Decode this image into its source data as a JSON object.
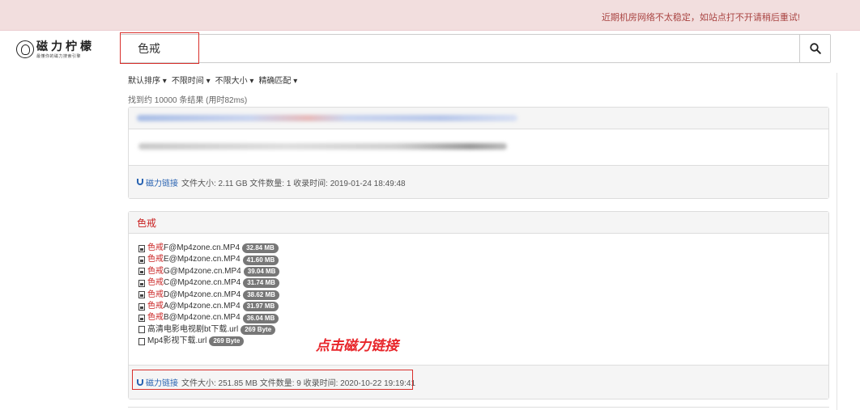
{
  "notice": {
    "text": "近期机房网络不太稳定，如站点打不开请稍后重试!"
  },
  "logo": {
    "title": "磁力柠檬",
    "subtitle": "最懂你的磁力搜索引擎"
  },
  "search": {
    "value": "色戒",
    "button_icon": "search-icon"
  },
  "filters": [
    "默认排序 ▾",
    "不限时间 ▾",
    "不限大小 ▾",
    "精确匹配 ▾"
  ],
  "result_count": "找到约 10000 条结果 (用时82ms)",
  "results": [
    {
      "title": "",
      "magnet_label": "磁力链接",
      "meta": "文件大小: 2.11 GB 文件数量: 1 收录时间: 2019-01-24 18:49:48"
    },
    {
      "title": "色戒",
      "magnet_label": "磁力链接",
      "meta": "文件大小: 251.85 MB 文件数量: 9 收录时间: 2020-10-22 19:19:41",
      "files": [
        {
          "highlight": "色戒",
          "name": "F@Mp4zone.cn.MP4",
          "size": "32.84 MB"
        },
        {
          "highlight": "色戒",
          "name": "E@Mp4zone.cn.MP4",
          "size": "41.60 MB"
        },
        {
          "highlight": "色戒",
          "name": "G@Mp4zone.cn.MP4",
          "size": "39.04 MB"
        },
        {
          "highlight": "色戒",
          "name": "C@Mp4zone.cn.MP4",
          "size": "31.74 MB"
        },
        {
          "highlight": "色戒",
          "name": "D@Mp4zone.cn.MP4",
          "size": "38.62 MB"
        },
        {
          "highlight": "色戒",
          "name": "A@Mp4zone.cn.MP4",
          "size": "31.97 MB"
        },
        {
          "highlight": "色戒",
          "name": "B@Mp4zone.cn.MP4",
          "size": "36.04 MB"
        },
        {
          "highlight": "",
          "name": "高清电影电视剧bt下载.url",
          "size": "269 Byte"
        },
        {
          "highlight": "",
          "name": "Mp4影视下载.url",
          "size": "269 Byte"
        }
      ]
    }
  ],
  "annotation": "点击磁力链接",
  "colors": {
    "accent_red": "#c81f1f",
    "link_blue": "#2a64b2",
    "notice_bg": "#f2dede"
  }
}
